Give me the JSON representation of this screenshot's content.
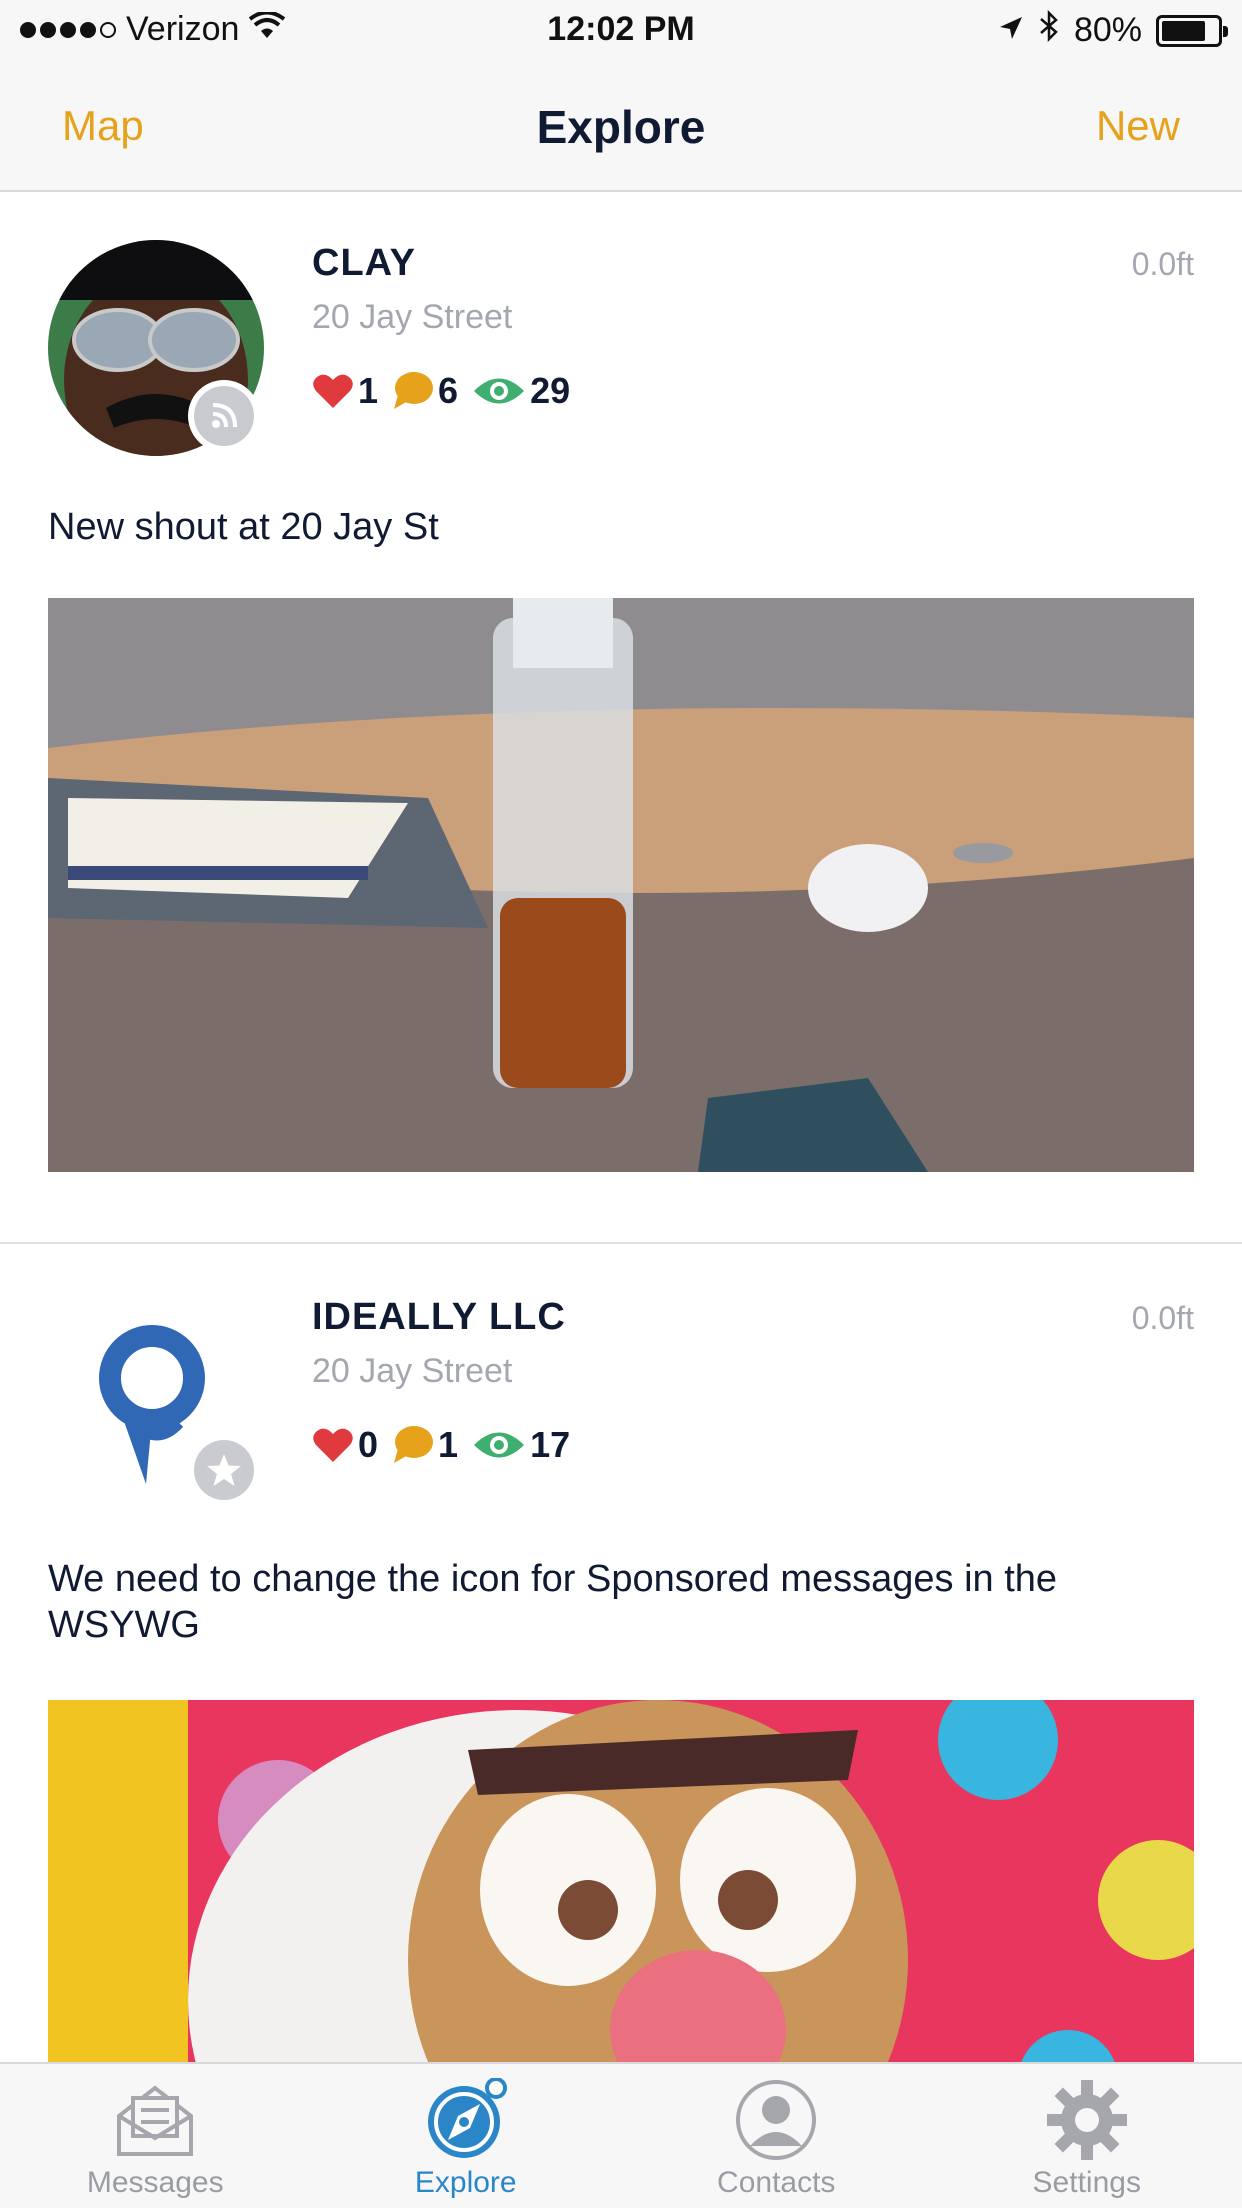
{
  "status_bar": {
    "carrier": "Verizon",
    "time": "12:02 PM",
    "battery": "80%",
    "battery_level": 0.8,
    "signal_bars": 4
  },
  "nav": {
    "left": "Map",
    "title": "Explore",
    "right": "New"
  },
  "colors": {
    "accent": "#e5a21a",
    "tab_active": "#2b86c8",
    "heart": "#e03a3e",
    "comment": "#e5a21a",
    "views": "#3fae6e"
  },
  "posts": [
    {
      "name": "CLAY",
      "distance": "0.0ft",
      "address": "20 Jay Street",
      "likes": "1",
      "comments": "6",
      "views": "29",
      "badge_icon": "broadcast-icon",
      "text": "New shout at 20 Jay St"
    },
    {
      "name": "IDEALLY LLC",
      "distance": "0.0ft",
      "address": "20 Jay Street",
      "likes": "0",
      "comments": "1",
      "views": "17",
      "badge_icon": "star-icon",
      "text": "We need to change the icon for Sponsored messages in the WSYWG"
    }
  ],
  "tabs": [
    {
      "label": "Messages",
      "icon": "messages-icon",
      "active": false
    },
    {
      "label": "Explore",
      "icon": "compass-icon",
      "active": true
    },
    {
      "label": "Contacts",
      "icon": "contacts-icon",
      "active": false
    },
    {
      "label": "Settings",
      "icon": "gear-icon",
      "active": false
    }
  ]
}
